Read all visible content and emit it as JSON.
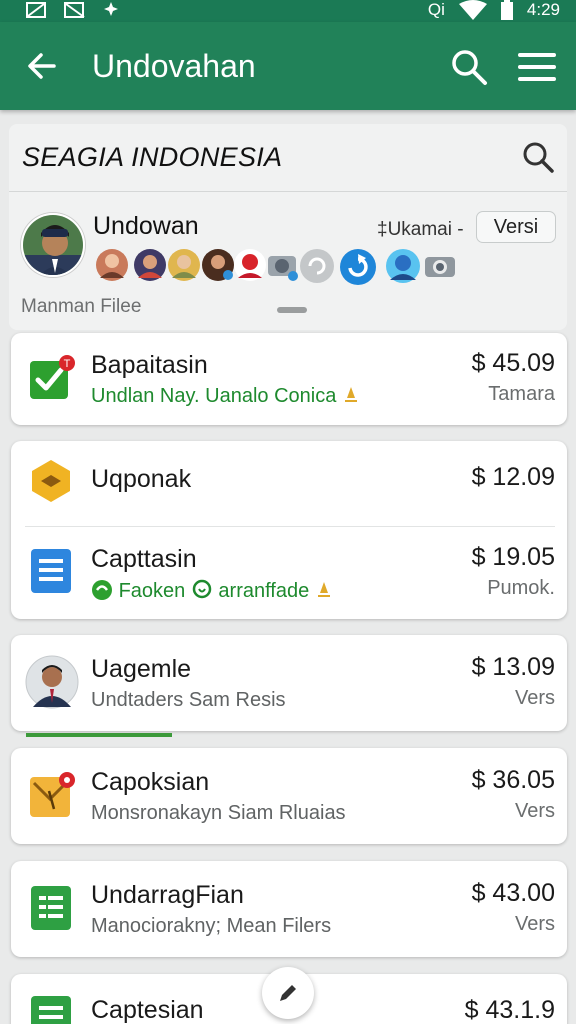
{
  "status_bar": {
    "time": "4:29",
    "carrier": "Qi"
  },
  "app_bar": {
    "title": "Undovahan"
  },
  "filter": {
    "title": "SEAGIA INDONESIA",
    "user_name": "Undowan",
    "dropdown_label": "‡Ukamai -",
    "version_button": "Versi",
    "sub_label": "Manman Filee"
  },
  "progress": {
    "fraction": 0.27,
    "color": "#3c9a3a"
  },
  "items": [
    {
      "name": "Bapaitasin",
      "subtitle": "Undlan Nay. Uanalo Conica",
      "price": "$ 45.09",
      "meta": "Tamara",
      "icon": "check-icon",
      "color": "#2da02f",
      "badge": "T"
    },
    {
      "name": "Uqponak",
      "subtitle": "",
      "price": "$ 12.09",
      "meta": "",
      "icon": "hexagon-icon",
      "color": "#f0b323"
    },
    {
      "name": "Capttasin",
      "subtitle": "Faoken",
      "subtitle_extra": "arranffade",
      "price": "$ 19.05",
      "meta": "Pumok.",
      "icon": "sheet-icon",
      "color": "#2e86de"
    },
    {
      "name": "Uagemle",
      "subtitle": "Undtaders Sam Resis",
      "price": "$ 13.09",
      "meta": "Vers",
      "icon": "person-avatar"
    },
    {
      "name": "Capoksian",
      "subtitle": "Monsronakayn Siam Rluaias",
      "price": "$ 36.05",
      "meta": "Vers",
      "icon": "envelope-icon",
      "color": "#f2b43a",
      "badge": ""
    },
    {
      "name": "UndarragFian",
      "subtitle": "Manociorakny; Mean Filers",
      "price": "$ 43.00",
      "meta": "Vers",
      "icon": "sheet-icon",
      "color": "#2ea043"
    },
    {
      "name": "Captesian",
      "subtitle": "",
      "price": "$ 43.1.9",
      "meta": "",
      "icon": "sheet-icon",
      "color": "#2ea043"
    }
  ]
}
